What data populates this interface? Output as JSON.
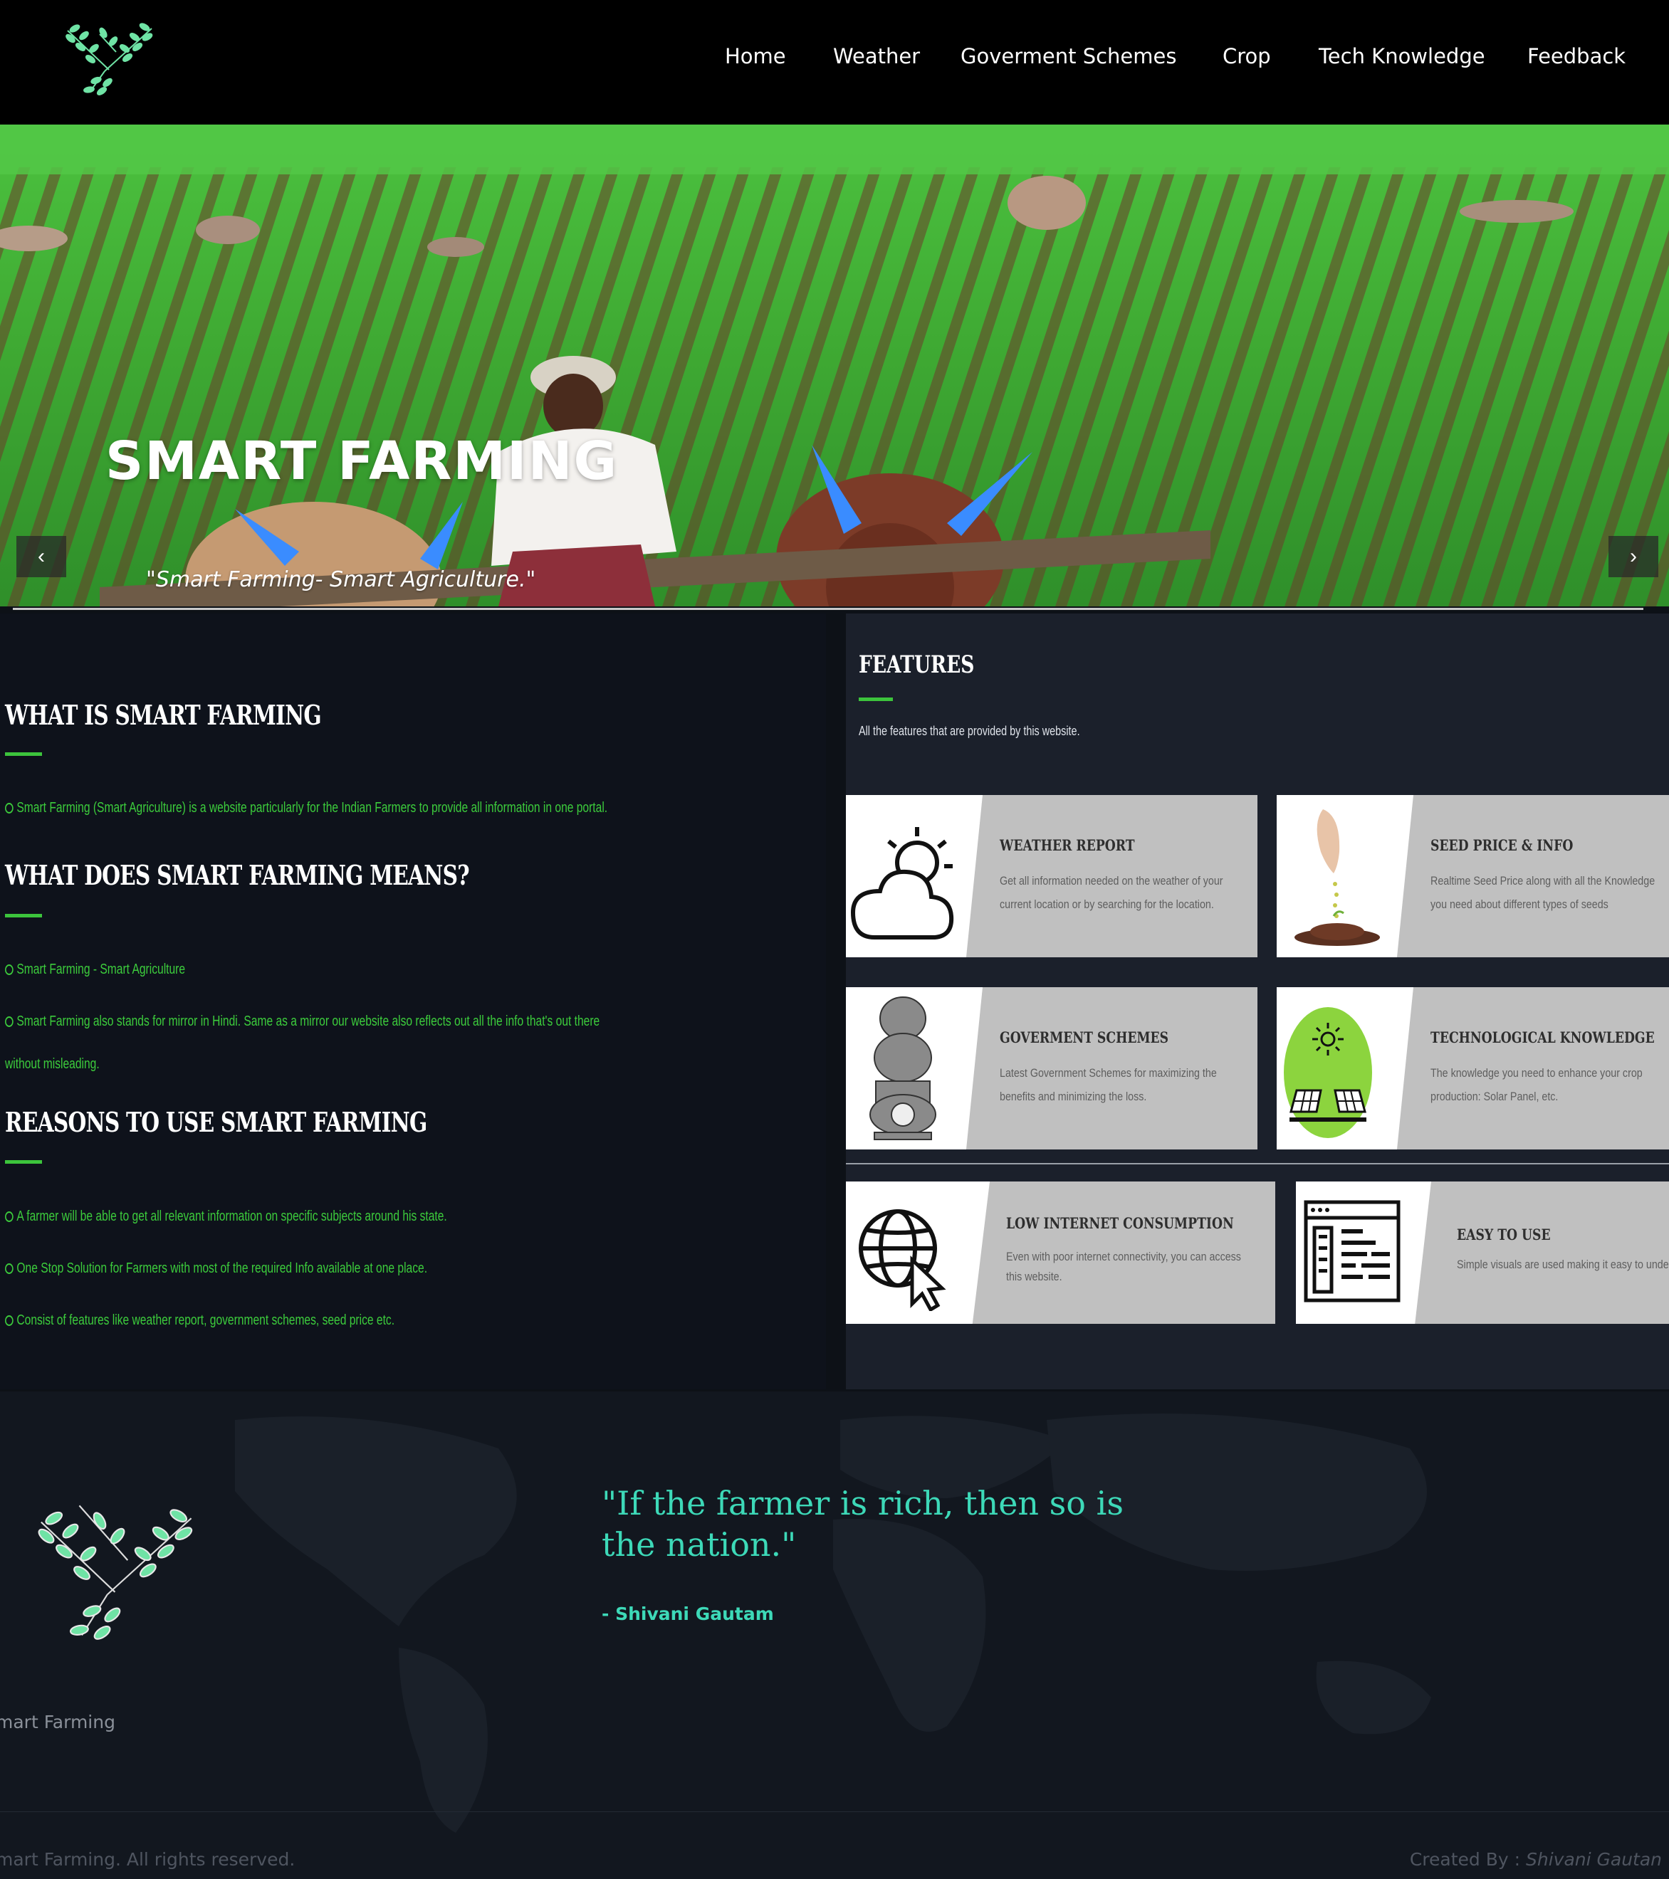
{
  "nav": {
    "items": [
      {
        "label": "Home"
      },
      {
        "label": "Weather"
      },
      {
        "label": "Goverment Schemes"
      },
      {
        "label": "Crop"
      },
      {
        "label": "Tech Knowledge"
      },
      {
        "label": "Feedback"
      }
    ]
  },
  "hero": {
    "title": "SMART FARMING",
    "subtitle": "\"Smart Farming- Smart Agriculture.\"",
    "prev_icon": "chevron-left-icon",
    "next_icon": "chevron-right-icon",
    "prev_label": "‹",
    "next_label": "›"
  },
  "about": {
    "heading1": "WHAT IS SMART FARMING",
    "line1": "Smart Farming (Smart Agriculture) is a website particularly for the Indian Farmers to provide all information in one portal.",
    "heading2": "WHAT DOES SMART FARMING MEANS?",
    "line2": "Smart Farming - Smart Agriculture",
    "line3a": "Smart Farming also stands for mirror in Hindi. Same as a mirror our website also reflects out all the info that's out there",
    "line3b": "without misleading.",
    "heading3": "REASONS TO USE SMART FARMING",
    "reasons": [
      "A farmer will be able to get all relevant information on specific subjects around his state.",
      "One Stop Solution for Farmers with most of the required Info available at one place.",
      "Consist of features like weather report, government schemes, seed price etc."
    ]
  },
  "features": {
    "title": "FEATURES",
    "description": "All the features that are provided by this website.",
    "cards": [
      {
        "title": "WEATHER REPORT",
        "line1": "Get all information needed on the weather of your",
        "line2": "current location or by searching for the location.",
        "icon": "weather-icon"
      },
      {
        "title": "SEED PRICE & INFO",
        "line1": "Realtime Seed Price along with all the Knowledge",
        "line2": "you need about different types of seeds",
        "icon": "seed-icon"
      },
      {
        "title": "GOVERMENT SCHEMES",
        "line1": "Latest Government Schemes for maximizing the",
        "line2": "benefits and minimizing the loss.",
        "icon": "emblem-icon"
      },
      {
        "title": "TECHNOLOGICAL KNOWLEDGE",
        "line1": "The knowledge you need to enhance your crop",
        "line2": "production: Solar Panel, etc.",
        "icon": "solar-panel-icon"
      },
      {
        "title": "LOW INTERNET CONSUMPTION",
        "line1": "Even with poor internet connectivity, you can access",
        "line2": "this website.",
        "icon": "globe-cursor-icon"
      },
      {
        "title": "EASY TO USE",
        "line1": "Simple visuals are used making it easy to unde",
        "line2": "",
        "icon": "layout-icon"
      }
    ]
  },
  "footer": {
    "quote_line1": "\"If the farmer is rich, then so is",
    "quote_line2": "the nation.\"",
    "author": "- Shivani Gautam",
    "brand": "mart Farming",
    "copyright": "mart Farming. All rights reserved.",
    "created_label": "Created By : ",
    "created_name": "Shivani Gautan"
  },
  "colors": {
    "accent_green": "#3cc43c",
    "quote_teal": "#3dd9b8",
    "nav_bg": "#000000",
    "panel_dark": "#0e121b"
  }
}
